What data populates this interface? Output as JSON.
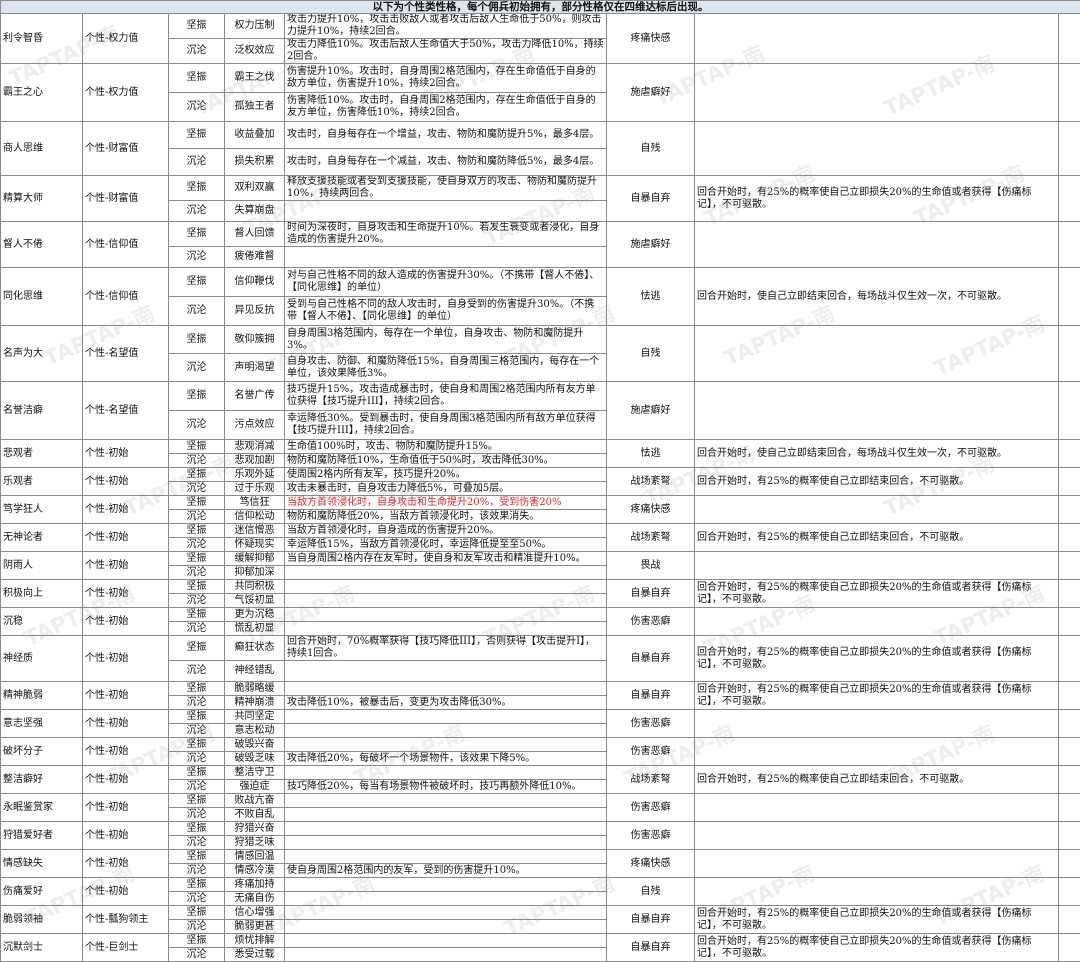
{
  "header": "以下为个性类性格，每个佣兵初始拥有，部分性格仅在四维达标后出现。",
  "watermark": "TAPTAP-南",
  "colors": {
    "highlight_text": "#e0262a",
    "header_bg": "#dce6f1"
  },
  "rows": [
    {
      "name": "利令智昏",
      "cat": "个性-权力值",
      "h": 46,
      "neg": "疼痛快感",
      "eff": "",
      "a": "坚振",
      "an": "权力压制",
      "ad": "攻击力提升10%，攻击击败敌人或者攻击后敌人生命低于50%，则攻击力提升10%，持续2回合。",
      "b": "沉沦",
      "bn": "泛权效应",
      "bd": "攻击力降低10%。攻击后敌人生命值大于50%，攻击力降低10%，持续2回合。"
    },
    {
      "name": "霸王之心",
      "cat": "个性-权力值",
      "h": 58,
      "neg": "施虐癖好",
      "eff": "",
      "a": "坚振",
      "an": "霸王之伐",
      "ad": "伤害提升10%。攻击时，自身周围2格范围内，存在生命值低于自身的敌方单位，伤害提升10%，持续2回合。",
      "b": "沉沦",
      "bn": "孤独王者",
      "bd": "伤害降低10%。攻击时，自身周围2格范围内，存在生命值低于自身的友方单位，伤害降低10%，持续2回合。"
    },
    {
      "name": "商人思维",
      "cat": "个性-财富值",
      "h": 54,
      "neg": "自残",
      "eff": "",
      "a": "坚振",
      "an": "收益叠加",
      "ad": "攻击时，自身每存在一个增益，攻击、物防和魔防提升5%，最多4层。",
      "b": "沉沦",
      "bn": "损失积累",
      "bd": "攻击时，自身每存在一个减益，攻击、物防和魔防降低5%，最多4层。"
    },
    {
      "name": "精算大师",
      "cat": "个性-财富值",
      "h": 42,
      "neg": "自暴自弃",
      "eff": "回合开始时，有25%的概率使自己立即损失20%的生命值或者获得【伤痛标记】，不可驱散。",
      "a": "坚振",
      "an": "双利双赢",
      "ad": "释放支援技能或者受到支援技能，使自身双方的攻击、物防和魔防提升10%，持续两回合。",
      "b": "沉沦",
      "bn": "失算崩盘",
      "bd": ""
    },
    {
      "name": "督人不倦",
      "cat": "个性-信仰值",
      "h": 42,
      "neg": "施虐癖好",
      "eff": "",
      "a": "坚振",
      "an": "督人回馈",
      "ad": "时间为深夜时，自身攻击和生命提升10%。若发生衰变或者浸化，自身造成的伤害提升20%。",
      "b": "沉沦",
      "bn": "疲倦难督",
      "bd": ""
    },
    {
      "name": "同化思维",
      "cat": "个性-信仰值",
      "h": 58,
      "neg": "怯逃",
      "eff": "回合开始时，使自己立即结束回合，每场战斗仅生效一次，不可驱散。",
      "a": "坚振",
      "an": "信仰鞭伐",
      "ad": "对与自己性格不同的敌人造成的伤害提升30%。（不携带【督人不倦】、【同化思维】的单位）",
      "b": "沉沦",
      "bn": "异见反抗",
      "bd": "受到与自己性格不同的敌人攻击时，自身受到的伤害提升30%。（不携带【督人不倦】、【同化思维】的单位）"
    },
    {
      "name": "名声为大",
      "cat": "个性-名望值",
      "h": 56,
      "neg": "自残",
      "eff": "",
      "a": "坚振",
      "an": "敬仰簇拥",
      "ad": "自身周围3格范围内，每存在一个单位，自身攻击、物防和魔防提升3%。",
      "b": "沉沦",
      "bn": "声明渴望",
      "bd": "自身攻击、防御、和魔防降低15%，自身周围三格范围内，每存在一个单位，该效果降低3%。"
    },
    {
      "name": "名誉洁癖",
      "cat": "个性-名望值",
      "h": 58,
      "neg": "施虐癖好",
      "eff": "",
      "a": "坚振",
      "an": "名誉广传",
      "ad": "技巧提升15%，攻击造成暴击时，使自身和周围2格范围内所有友方单位获得【技巧提升III】，持续2回合。",
      "b": "沉沦",
      "bn": "污点效应",
      "bd": "幸运降低30%。受到暴击时，使自身周围3格范围内所有敌方单位获得【技巧提升III】，持续2回合。"
    },
    {
      "name": "悲观者",
      "cat": "个性-初始",
      "h": 28,
      "neg": "怯逃",
      "eff": "回合开始时，使自己立即结束回合，每场战斗仅生效一次，不可驱散。",
      "a": "坚振",
      "an": "悲观消减",
      "ad": "生命值100%时，攻击、物防和魔防提升15%。",
      "b": "沉沦",
      "bn": "悲观加剧",
      "bd": "物防和魔防降低10%，生命值低于50%时，攻击降低30%。"
    },
    {
      "name": "乐观者",
      "cat": "个性-初始",
      "h": 28,
      "neg": "战场紊弩",
      "eff": "回合开始时，有25%的概率使自己立即结束回合，不可驱散。",
      "a": "坚振",
      "an": "乐观外延",
      "ad": "使周围2格内所有友军，技巧提升20%。",
      "b": "沉沦",
      "bn": "过于乐观",
      "bd": "攻击未暴击时，自身攻击力降低5%，可叠加5层。"
    },
    {
      "name": "笃学狂人",
      "cat": "个性-初始",
      "h": 28,
      "neg": "疼痛快感",
      "eff": "",
      "red": true,
      "a": "坚振",
      "an": "笃信狂",
      "ad": "当敌方首领浸化时，自身攻击和生命提升20%，受到伤害20%",
      "b": "沉沦",
      "bn": "信仰松动",
      "bd": "物防和魔防降低20%，当敌方首领浸化时，该效果消失。"
    },
    {
      "name": "无神论者",
      "cat": "个性-初始",
      "h": 28,
      "neg": "战场紊弩",
      "eff": "回合开始时，有25%的概率使自己立即结束回合，不可驱散。",
      "a": "坚振",
      "an": "迷信憎恶",
      "ad": "当敌方首领浸化时，自身造成的伤害提升20%。",
      "b": "沉沦",
      "bn": "怀疑现实",
      "bd": "幸运降低15%，当敌方首领浸化时，幸运降低提至至50%。"
    },
    {
      "name": "阴雨人",
      "cat": "个性-初始",
      "h": 28,
      "neg": "畏战",
      "eff": "",
      "a": "坚振",
      "an": "缓解抑郁",
      "ad": "当自身周围2格内存在友军时，使自身和友军攻击和精准提升10%。",
      "b": "沉沦",
      "bn": "抑郁加深",
      "bd": ""
    },
    {
      "name": "积极向上",
      "cat": "个性-初始",
      "h": 28,
      "neg": "自暴自弃",
      "eff": "回合开始时，有25%的概率使自己立即损失20%的生命值或者获得【伤痛标记】，不可驱散。",
      "a": "坚振",
      "an": "共同积极",
      "ad": "",
      "b": "沉沦",
      "bn": "气馁初显",
      "bd": ""
    },
    {
      "name": "沉稳",
      "cat": "个性-初始",
      "h": 28,
      "neg": "伤害恶癖",
      "eff": "",
      "a": "坚振",
      "an": "更为沉稳",
      "ad": "",
      "b": "沉沦",
      "bn": "慌乱初显",
      "bd": ""
    },
    {
      "name": "神经质",
      "cat": "个性-初始",
      "h": 42,
      "neg": "自暴自弃",
      "eff": "回合开始时，有25%的概率使自己立即损失20%的生命值或者获得【伤痛标记】，不可驱散。",
      "a": "坚振",
      "an": "癫狂状态",
      "ad": "回合开始时，70%概率获得【技巧降低III】，否则获得【攻击提升I】，持续1回合。",
      "b": "沉沦",
      "bn": "神经错乱",
      "bd": ""
    },
    {
      "name": "精神脆弱",
      "cat": "个性-初始",
      "h": 28,
      "neg": "自暴自弃",
      "eff": "回合开始时，有25%的概率使自己立即损失20%的生命值或者获得【伤痛标记】，不可驱散。",
      "a": "坚振",
      "an": "脆弱略缓",
      "ad": "",
      "b": "沉沦",
      "bn": "精神崩溃",
      "bd": "攻击降低10%，被暴击后，变更为攻击降低30%。"
    },
    {
      "name": "意志坚强",
      "cat": "个性-初始",
      "h": 28,
      "neg": "伤害恶癖",
      "eff": "",
      "a": "坚振",
      "an": "共同坚定",
      "ad": "",
      "b": "沉沦",
      "bn": "意志松动",
      "bd": ""
    },
    {
      "name": "破坏分子",
      "cat": "个性-初始",
      "h": 28,
      "neg": "伤害恶癖",
      "eff": "",
      "a": "坚振",
      "an": "破毁兴奋",
      "ad": "",
      "b": "沉沦",
      "bn": "破毁乏味",
      "bd": "攻击降低20%，每破坏一个场景物件，该效果下降5%。"
    },
    {
      "name": "整洁癖好",
      "cat": "个性-初始",
      "h": 28,
      "neg": "战场紊弩",
      "eff": "回合开始时，有25%的概率使自己立即结束回合，不可驱散。",
      "a": "坚振",
      "an": "整洁守卫",
      "ad": "",
      "b": "沉沦",
      "bn": "强迫症",
      "bd": "技巧降低20%，每当有场景物件被破坏时，技巧再额外降低10%。"
    },
    {
      "name": "永眠鉴赏家",
      "cat": "个性-初始",
      "h": 28,
      "neg": "伤害恶癖",
      "eff": "",
      "a": "坚振",
      "an": "败战亢奋",
      "ad": "",
      "b": "沉沦",
      "bn": "不败自乱",
      "bd": ""
    },
    {
      "name": "狩猎爱好者",
      "cat": "个性-初始",
      "h": 28,
      "neg": "伤害恶癖",
      "eff": "",
      "a": "坚振",
      "an": "狩猎兴奋",
      "ad": "",
      "b": "沉沦",
      "bn": "狩猎乏味",
      "bd": ""
    },
    {
      "name": "情感缺失",
      "cat": "个性-初始",
      "h": 28,
      "neg": "疼痛快感",
      "eff": "",
      "a": "坚振",
      "an": "情感回温",
      "ad": "",
      "b": "沉沦",
      "bn": "情感冷漠",
      "bd": "使自身周围2格范围内的友军，受到的伤害提升10%。"
    },
    {
      "name": "伤痛爱好",
      "cat": "个性-初始",
      "h": 28,
      "neg": "自残",
      "eff": "",
      "a": "坚振",
      "an": "疼痛加持",
      "ad": "",
      "b": "沉沦",
      "bn": "无痛自伤",
      "bd": ""
    },
    {
      "name": "脆弱领袖",
      "cat": "个性-瓢狗领主",
      "h": 28,
      "neg": "自暴自弃",
      "eff": "回合开始时，有25%的概率使自己立即损失20%的生命值或者获得【伤痛标记】，不可驱散。",
      "a": "坚振",
      "an": "信心增强",
      "ad": "",
      "b": "沉沦",
      "bn": "脆弱更甚",
      "bd": ""
    },
    {
      "name": "沉默剑士",
      "cat": "个性-巨剑士",
      "h": 28,
      "neg": "自暴自弃",
      "eff": "回合开始时，有25%的概率使自己立即损失20%的生命值或者获得【伤痛标记】，不可驱散。",
      "a": "坚振",
      "an": "烦忧排解",
      "ad": "",
      "b": "沉沦",
      "bn": "悉受过载",
      "bd": ""
    }
  ]
}
